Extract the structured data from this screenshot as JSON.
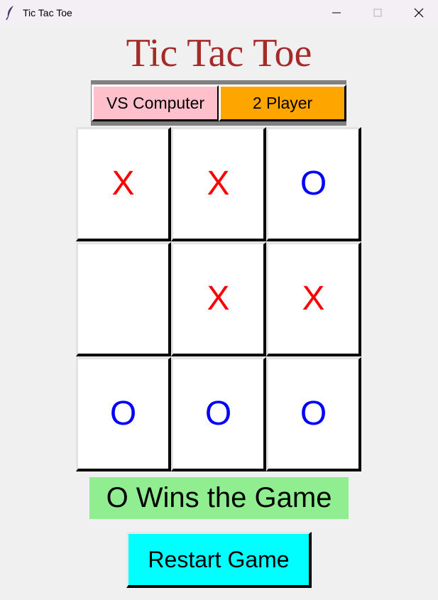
{
  "window": {
    "title": "Tic Tac Toe",
    "icon": "feather-icon"
  },
  "game": {
    "title": "Tic Tac Toe",
    "modes": [
      {
        "label": "VS Computer",
        "color": "#ffc0cb",
        "selected": false
      },
      {
        "label": "2 Player",
        "color": "#ffa500",
        "selected": true
      }
    ],
    "board": [
      [
        "X",
        "X",
        "O"
      ],
      [
        "",
        "X",
        "X"
      ],
      [
        "O",
        "O",
        "O"
      ]
    ],
    "x_color": "#ff0000",
    "o_color": "#0000ff",
    "status": "O Wins the Game",
    "status_color": "#90ee90",
    "restart_label": "Restart Game",
    "restart_color": "#00ffff",
    "title_color": "#a52a2a"
  }
}
